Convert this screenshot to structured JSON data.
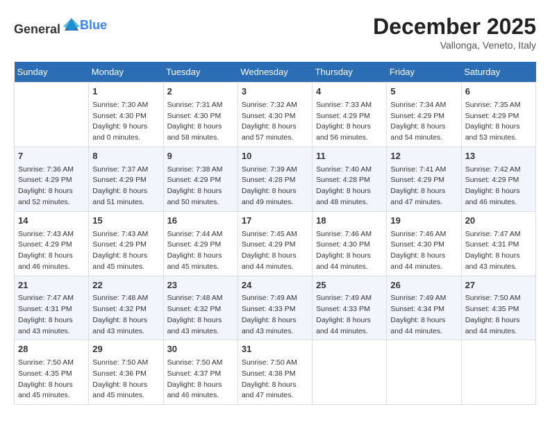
{
  "logo": {
    "text_general": "General",
    "text_blue": "Blue"
  },
  "header": {
    "title": "December 2025",
    "subtitle": "Vallonga, Veneto, Italy"
  },
  "weekdays": [
    "Sunday",
    "Monday",
    "Tuesday",
    "Wednesday",
    "Thursday",
    "Friday",
    "Saturday"
  ],
  "weeks": [
    [
      {
        "day": "",
        "sunrise": "",
        "sunset": "",
        "daylight": "",
        "empty": true
      },
      {
        "day": "1",
        "sunrise": "Sunrise: 7:30 AM",
        "sunset": "Sunset: 4:30 PM",
        "daylight": "Daylight: 9 hours and 0 minutes."
      },
      {
        "day": "2",
        "sunrise": "Sunrise: 7:31 AM",
        "sunset": "Sunset: 4:30 PM",
        "daylight": "Daylight: 8 hours and 58 minutes."
      },
      {
        "day": "3",
        "sunrise": "Sunrise: 7:32 AM",
        "sunset": "Sunset: 4:30 PM",
        "daylight": "Daylight: 8 hours and 57 minutes."
      },
      {
        "day": "4",
        "sunrise": "Sunrise: 7:33 AM",
        "sunset": "Sunset: 4:29 PM",
        "daylight": "Daylight: 8 hours and 56 minutes."
      },
      {
        "day": "5",
        "sunrise": "Sunrise: 7:34 AM",
        "sunset": "Sunset: 4:29 PM",
        "daylight": "Daylight: 8 hours and 54 minutes."
      },
      {
        "day": "6",
        "sunrise": "Sunrise: 7:35 AM",
        "sunset": "Sunset: 4:29 PM",
        "daylight": "Daylight: 8 hours and 53 minutes."
      }
    ],
    [
      {
        "day": "7",
        "sunrise": "Sunrise: 7:36 AM",
        "sunset": "Sunset: 4:29 PM",
        "daylight": "Daylight: 8 hours and 52 minutes."
      },
      {
        "day": "8",
        "sunrise": "Sunrise: 7:37 AM",
        "sunset": "Sunset: 4:29 PM",
        "daylight": "Daylight: 8 hours and 51 minutes."
      },
      {
        "day": "9",
        "sunrise": "Sunrise: 7:38 AM",
        "sunset": "Sunset: 4:29 PM",
        "daylight": "Daylight: 8 hours and 50 minutes."
      },
      {
        "day": "10",
        "sunrise": "Sunrise: 7:39 AM",
        "sunset": "Sunset: 4:28 PM",
        "daylight": "Daylight: 8 hours and 49 minutes."
      },
      {
        "day": "11",
        "sunrise": "Sunrise: 7:40 AM",
        "sunset": "Sunset: 4:28 PM",
        "daylight": "Daylight: 8 hours and 48 minutes."
      },
      {
        "day": "12",
        "sunrise": "Sunrise: 7:41 AM",
        "sunset": "Sunset: 4:29 PM",
        "daylight": "Daylight: 8 hours and 47 minutes."
      },
      {
        "day": "13",
        "sunrise": "Sunrise: 7:42 AM",
        "sunset": "Sunset: 4:29 PM",
        "daylight": "Daylight: 8 hours and 46 minutes."
      }
    ],
    [
      {
        "day": "14",
        "sunrise": "Sunrise: 7:43 AM",
        "sunset": "Sunset: 4:29 PM",
        "daylight": "Daylight: 8 hours and 46 minutes."
      },
      {
        "day": "15",
        "sunrise": "Sunrise: 7:43 AM",
        "sunset": "Sunset: 4:29 PM",
        "daylight": "Daylight: 8 hours and 45 minutes."
      },
      {
        "day": "16",
        "sunrise": "Sunrise: 7:44 AM",
        "sunset": "Sunset: 4:29 PM",
        "daylight": "Daylight: 8 hours and 45 minutes."
      },
      {
        "day": "17",
        "sunrise": "Sunrise: 7:45 AM",
        "sunset": "Sunset: 4:29 PM",
        "daylight": "Daylight: 8 hours and 44 minutes."
      },
      {
        "day": "18",
        "sunrise": "Sunrise: 7:46 AM",
        "sunset": "Sunset: 4:30 PM",
        "daylight": "Daylight: 8 hours and 44 minutes."
      },
      {
        "day": "19",
        "sunrise": "Sunrise: 7:46 AM",
        "sunset": "Sunset: 4:30 PM",
        "daylight": "Daylight: 8 hours and 44 minutes."
      },
      {
        "day": "20",
        "sunrise": "Sunrise: 7:47 AM",
        "sunset": "Sunset: 4:31 PM",
        "daylight": "Daylight: 8 hours and 43 minutes."
      }
    ],
    [
      {
        "day": "21",
        "sunrise": "Sunrise: 7:47 AM",
        "sunset": "Sunset: 4:31 PM",
        "daylight": "Daylight: 8 hours and 43 minutes."
      },
      {
        "day": "22",
        "sunrise": "Sunrise: 7:48 AM",
        "sunset": "Sunset: 4:32 PM",
        "daylight": "Daylight: 8 hours and 43 minutes."
      },
      {
        "day": "23",
        "sunrise": "Sunrise: 7:48 AM",
        "sunset": "Sunset: 4:32 PM",
        "daylight": "Daylight: 8 hours and 43 minutes."
      },
      {
        "day": "24",
        "sunrise": "Sunrise: 7:49 AM",
        "sunset": "Sunset: 4:33 PM",
        "daylight": "Daylight: 8 hours and 43 minutes."
      },
      {
        "day": "25",
        "sunrise": "Sunrise: 7:49 AM",
        "sunset": "Sunset: 4:33 PM",
        "daylight": "Daylight: 8 hours and 44 minutes."
      },
      {
        "day": "26",
        "sunrise": "Sunrise: 7:49 AM",
        "sunset": "Sunset: 4:34 PM",
        "daylight": "Daylight: 8 hours and 44 minutes."
      },
      {
        "day": "27",
        "sunrise": "Sunrise: 7:50 AM",
        "sunset": "Sunset: 4:35 PM",
        "daylight": "Daylight: 8 hours and 44 minutes."
      }
    ],
    [
      {
        "day": "28",
        "sunrise": "Sunrise: 7:50 AM",
        "sunset": "Sunset: 4:35 PM",
        "daylight": "Daylight: 8 hours and 45 minutes."
      },
      {
        "day": "29",
        "sunrise": "Sunrise: 7:50 AM",
        "sunset": "Sunset: 4:36 PM",
        "daylight": "Daylight: 8 hours and 45 minutes."
      },
      {
        "day": "30",
        "sunrise": "Sunrise: 7:50 AM",
        "sunset": "Sunset: 4:37 PM",
        "daylight": "Daylight: 8 hours and 46 minutes."
      },
      {
        "day": "31",
        "sunrise": "Sunrise: 7:50 AM",
        "sunset": "Sunset: 4:38 PM",
        "daylight": "Daylight: 8 hours and 47 minutes."
      },
      {
        "day": "",
        "sunrise": "",
        "sunset": "",
        "daylight": "",
        "empty": true
      },
      {
        "day": "",
        "sunrise": "",
        "sunset": "",
        "daylight": "",
        "empty": true
      },
      {
        "day": "",
        "sunrise": "",
        "sunset": "",
        "daylight": "",
        "empty": true
      }
    ]
  ]
}
